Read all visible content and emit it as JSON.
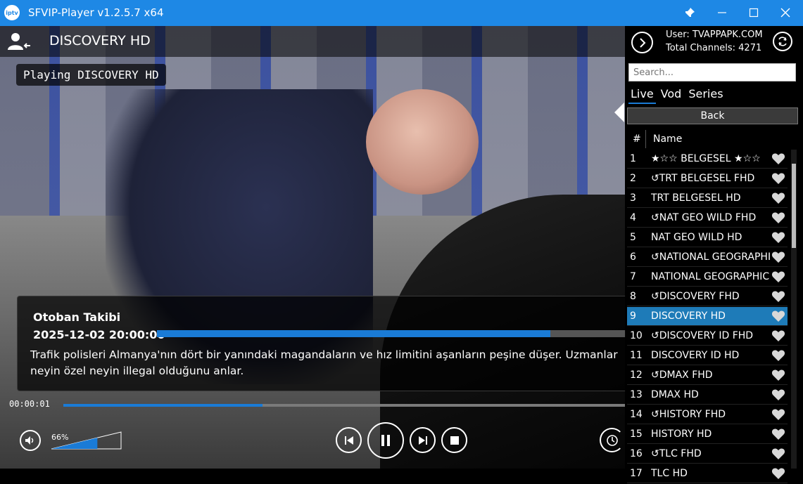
{
  "window": {
    "title": "SFVIP-Player v1.2.5.7 x64",
    "logo_text": "iptv"
  },
  "player": {
    "channel_title": "DISCOVERY HD",
    "playing_badge": "Playing DISCOVERY HD",
    "epg": {
      "program": "Otoban Takibi",
      "datetime": "2025-12-02 20:00:00",
      "progress_fraction": 0.84,
      "description": "Trafik polisleri Almanya'nın dört bir yanındaki magandaların ve hız limitini aşanların peşine düşer. Uzmanlar neyin özel neyin illegal olduğunu anlar."
    },
    "position": "00:00:01",
    "seek_fraction": 0.355,
    "volume_label": "66%",
    "volume_fraction": 0.66
  },
  "panel": {
    "user_label": "User: TVAPPAPK.COM",
    "total_label": "Total Channels: 4271",
    "search_placeholder": "Search...",
    "tabs": [
      {
        "label": "Live",
        "active": true
      },
      {
        "label": "Vod",
        "active": false
      },
      {
        "label": "Series",
        "active": false
      }
    ],
    "back_label": "Back",
    "col_num": "#",
    "col_name": "Name",
    "selected_index": 9,
    "channels": [
      {
        "num": "1",
        "name": "★☆☆ BELGESEL ★☆☆"
      },
      {
        "num": "2",
        "name": "↺TRT BELGESEL FHD"
      },
      {
        "num": "3",
        "name": "TRT BELGESEL HD"
      },
      {
        "num": "4",
        "name": "↺NAT GEO WILD FHD"
      },
      {
        "num": "5",
        "name": "NAT GEO WILD HD"
      },
      {
        "num": "6",
        "name": "↺NATIONAL GEOGRAPHIC FHD"
      },
      {
        "num": "7",
        "name": "NATIONAL GEOGRAPHIC HD"
      },
      {
        "num": "8",
        "name": "↺DISCOVERY FHD"
      },
      {
        "num": "9",
        "name": "DISCOVERY HD"
      },
      {
        "num": "10",
        "name": "↺DISCOVERY ID FHD"
      },
      {
        "num": "11",
        "name": "DISCOVERY ID HD"
      },
      {
        "num": "12",
        "name": "↺DMAX FHD"
      },
      {
        "num": "13",
        "name": "DMAX HD"
      },
      {
        "num": "14",
        "name": "↺HISTORY FHD"
      },
      {
        "num": "15",
        "name": "HISTORY HD"
      },
      {
        "num": "16",
        "name": "↺TLC FHD"
      },
      {
        "num": "17",
        "name": "TLC HD"
      }
    ]
  },
  "colors": {
    "accent": "#1e88e5",
    "progress": "#1a7bd6",
    "selected_row": "#1e7bb8"
  }
}
